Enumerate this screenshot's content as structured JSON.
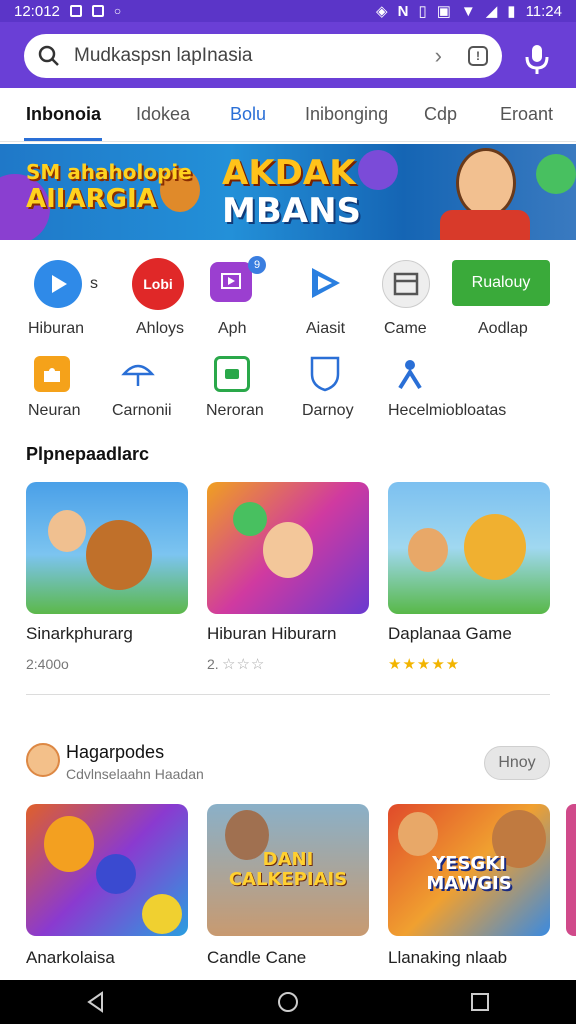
{
  "status_bar": {
    "time_left": "12:012",
    "time_right": "11:24",
    "letters": "N"
  },
  "search": {
    "placeholder": "Mudkaspsn lapInasia"
  },
  "tabs": [
    {
      "label": "Inbonoia"
    },
    {
      "label": "Idokea"
    },
    {
      "label": "Bolu"
    },
    {
      "label": "Inibonging"
    },
    {
      "label": "Cdp"
    },
    {
      "label": "Eroant"
    }
  ],
  "banner": {
    "left_text_1": "SM ahaholopie",
    "left_text_2": "AIIARGIA",
    "right_text_1": "AKDAK",
    "right_text_2": "MBANS"
  },
  "categories_row1": [
    {
      "label": "Hiburan",
      "icon": "play-icon",
      "extra": "s"
    },
    {
      "label": "Ahloys",
      "icon": "lobi-icon",
      "badge_text": "Lobi"
    },
    {
      "label": "Aph",
      "icon": "screen-play-icon",
      "badge": "9"
    },
    {
      "label": "Aiasit",
      "icon": "triangle-play-icon"
    },
    {
      "label": "Came",
      "icon": "window-icon"
    },
    {
      "label": "Aodlap",
      "button": "Rualouy"
    }
  ],
  "categories_row2": [
    {
      "label": "Neuran",
      "icon": "puzzle-icon"
    },
    {
      "label": "Carnonii",
      "icon": "umbrella-icon"
    },
    {
      "label": "Neroran",
      "icon": "gamepad-icon"
    },
    {
      "label": "Darnoy",
      "icon": "shield-icon"
    },
    {
      "label": "Hecelmiobloatas",
      "icon": "people-icon"
    }
  ],
  "section1": {
    "title": "Plpnepaadlarc",
    "cards": [
      {
        "title": "Sinarkphurarg",
        "sub": "2:400o",
        "rating": ""
      },
      {
        "title": "Hiburan Hiburarn",
        "sub": "2.",
        "rating": "☆☆☆"
      },
      {
        "title": "Daplanaa Game",
        "sub": "",
        "rating": "★★★★★"
      }
    ]
  },
  "section2": {
    "title": "Hagarpodes",
    "subtitle": "Cdvlnselaahn Haadan",
    "more_label": "Hnoy",
    "cards": [
      {
        "title": "Anarkolaisa",
        "art_text": ""
      },
      {
        "title": "Candle Cane",
        "art_text": "DANI CALKEPIAIS"
      },
      {
        "title": "Llanaking nlaab",
        "art_text": "YESGKI MAWGIS"
      }
    ]
  }
}
